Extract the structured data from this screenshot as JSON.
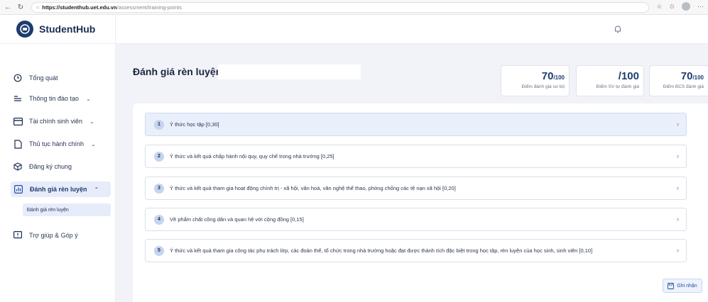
{
  "browser": {
    "url_host": "https://studenthub.uet.edu.vn",
    "url_path": "/assessment/training-points",
    "more_label": "···"
  },
  "brand": {
    "name": "StudentHub"
  },
  "sidebar": {
    "items": [
      {
        "label": "Tổng quát",
        "icon": "clock-icon"
      },
      {
        "label": "Thông tin đào tạo",
        "icon": "list-icon"
      },
      {
        "label": "Tài chính sinh viên",
        "icon": "card-icon"
      },
      {
        "label": "Thủ tục hành chính",
        "icon": "document-icon"
      },
      {
        "label": "Đăng ký chung",
        "icon": "cube-icon"
      },
      {
        "label": "Đánh giá rèn luyện",
        "icon": "chart-icon"
      },
      {
        "label": "Trợ giúp & Góp ý",
        "icon": "feedback-icon"
      }
    ],
    "sub_item": "Đánh giá rèn luyện"
  },
  "page": {
    "title": "Đánh giá rèn luyện:"
  },
  "scores": [
    {
      "value": "70",
      "max": "/100",
      "label": "Điểm đánh giá sơ bộ"
    },
    {
      "value": "",
      "max": "/100",
      "label": "Điểm SV tự đánh giá"
    },
    {
      "value": "70",
      "max": "/100",
      "label": "Điểm BCS đánh giá"
    }
  ],
  "criteria": [
    {
      "num": "1",
      "text": "Ý thức học tập [0,30]"
    },
    {
      "num": "2",
      "text": "Ý thức và kết quả chấp hành nội quy, quy chế trong nhà trường [0,25]"
    },
    {
      "num": "3",
      "text": "Ý thức và kết quả tham gia hoạt động chính trị - xã hội, văn hoá, văn nghệ thể thao, phòng chống các tệ nạn xã hội [0,20]"
    },
    {
      "num": "4",
      "text": "Về phẩm chất công dân và quan hệ với cộng đồng [0,15]"
    },
    {
      "num": "5",
      "text": "Ý thức và kết quả tham gia công tác phụ trách lớp, các đoàn thể, tổ chức trong nhà trường hoặc đạt được thành tích đặc biệt trong học tập, rèn luyện của học sinh, sinh viên [0,10]"
    }
  ],
  "actions": {
    "save_label": "Ghi nhận"
  },
  "colors": {
    "brand": "#1d3c6e",
    "active_bg": "#e7ecfb",
    "main_bg": "#f1f3f8"
  }
}
